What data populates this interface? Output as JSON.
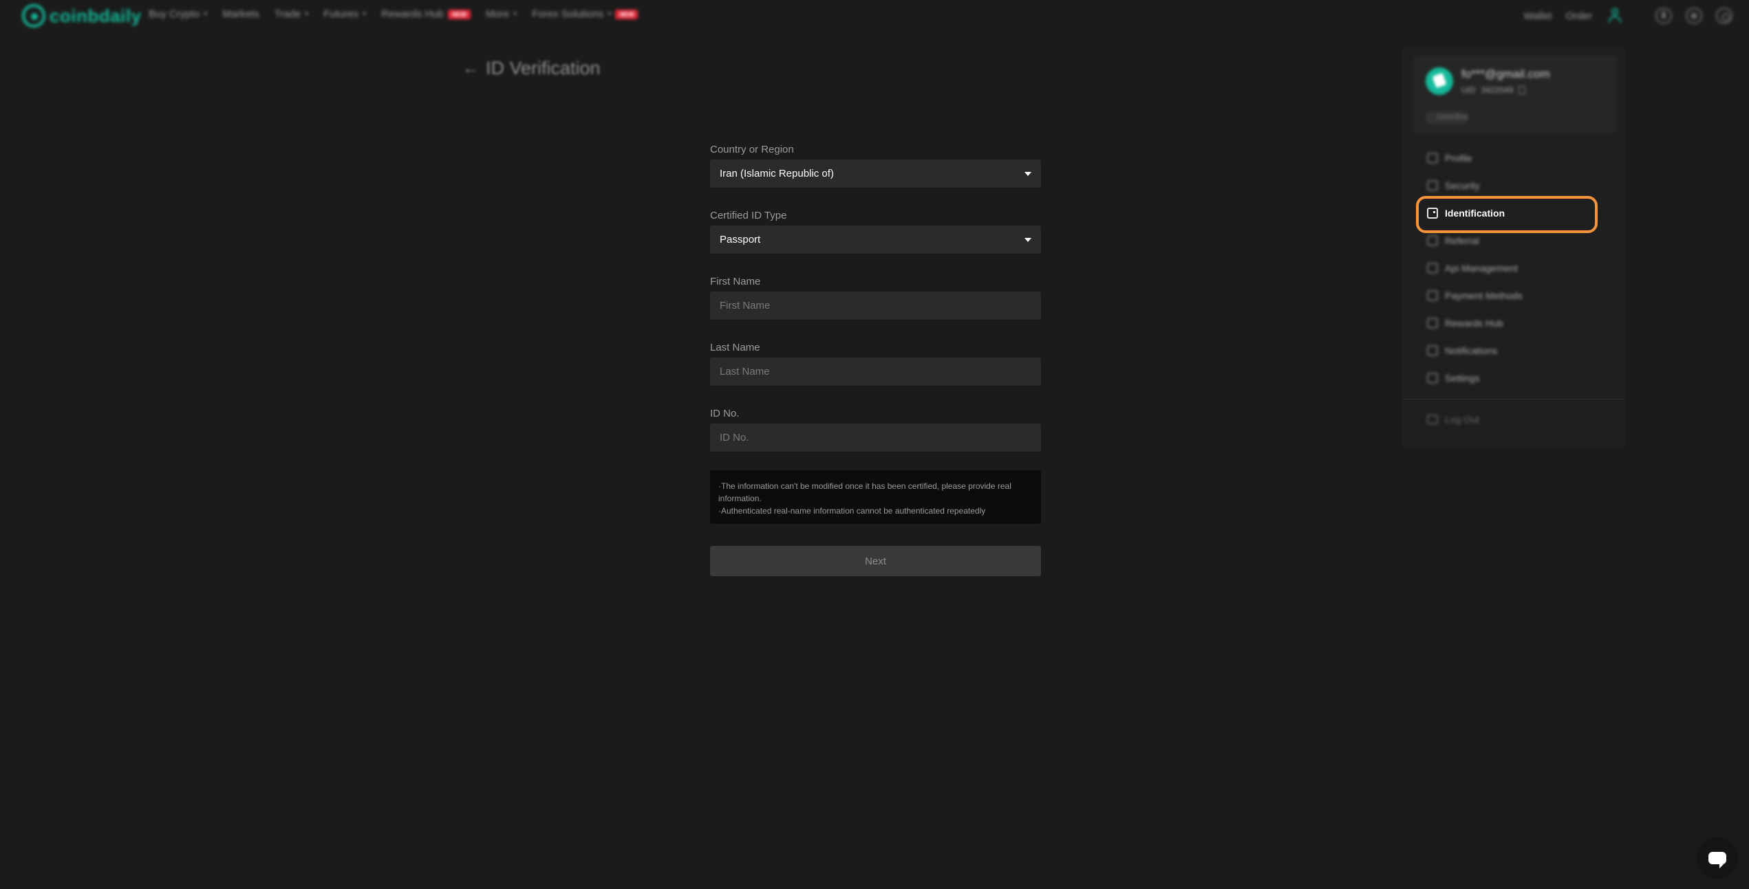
{
  "header": {
    "logo_text": "coinbdaily",
    "nav": [
      {
        "label": "Buy Crypto",
        "has_caret": true
      },
      {
        "label": "Markets",
        "has_caret": false
      },
      {
        "label": "Trade",
        "has_caret": true
      },
      {
        "label": "Futures",
        "has_caret": true
      },
      {
        "label": "Rewards Hub",
        "badge": "NEW"
      },
      {
        "label": "More",
        "has_caret": true
      },
      {
        "label": "Forex Solutions",
        "badge": "NEW"
      }
    ],
    "wallet_label": "Wallet",
    "order_label": "Order",
    "caret": "▾"
  },
  "page": {
    "back_arrow": "←",
    "title": "ID Verification"
  },
  "form": {
    "country": {
      "label": "Country or Region",
      "value": "Iran (Islamic Republic of)"
    },
    "id_type": {
      "label": "Certified ID Type",
      "value": "Passport"
    },
    "first_name": {
      "label": "First Name",
      "placeholder": "First Name",
      "value": ""
    },
    "last_name": {
      "label": "Last Name",
      "placeholder": "Last Name",
      "value": ""
    },
    "id_no": {
      "label": "ID No.",
      "placeholder": "ID No.",
      "value": ""
    },
    "notice_line1": "·The information can't be modified once it has been certified, please provide real information.",
    "notice_line2": "·Authenticated real-name information cannot be authenticated repeatedly",
    "next_label": "Next"
  },
  "sidebar": {
    "email": "fo***@gmail.com",
    "uid_label": "UID",
    "uid": "3422049",
    "status": "Unverified",
    "items": [
      {
        "label": "Profile",
        "icon": "person-icon"
      },
      {
        "label": "Security",
        "icon": "shield-icon"
      },
      {
        "label": "Identification",
        "icon": "id-card-icon",
        "active": true
      },
      {
        "label": "Referral",
        "icon": "gift-icon"
      },
      {
        "label": "Api Management",
        "icon": "api-icon"
      },
      {
        "label": "Payment Methods",
        "icon": "card-icon"
      },
      {
        "label": "Rewards Hub",
        "icon": "reward-icon"
      },
      {
        "label": "Notifications",
        "icon": "bell-icon"
      },
      {
        "label": "Settings",
        "icon": "gear-icon"
      }
    ],
    "logout_label": "Log Out"
  },
  "colors": {
    "accent": "#14b89a",
    "highlight": "#f5943a",
    "badge": "#e2283a"
  }
}
